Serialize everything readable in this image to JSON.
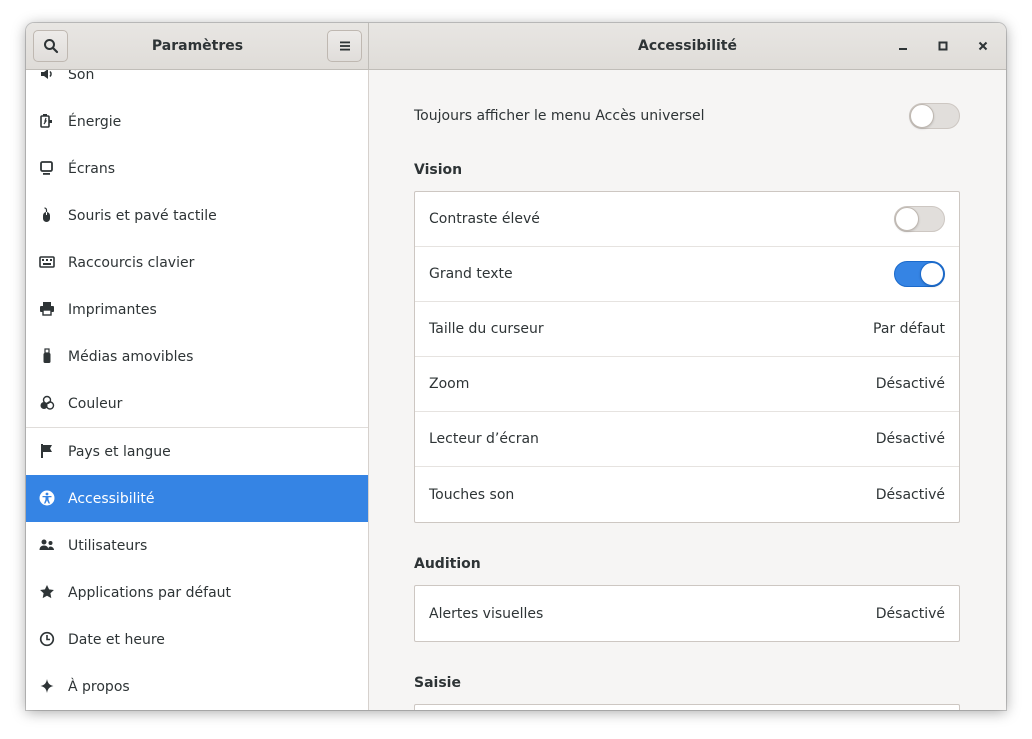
{
  "window": {
    "sidebar_title": "Paramètres",
    "page_title": "Accessibilité"
  },
  "icons": {
    "search": "search-icon",
    "menu": "hamburger-menu-icon",
    "minimize": "minimize-icon",
    "maximize": "maximize-icon",
    "close": "close-icon"
  },
  "colors": {
    "accent": "#3584e4",
    "sidebar_bg": "#ffffff",
    "content_bg": "#f6f5f4"
  },
  "sidebar": {
    "items": [
      {
        "label": "Son",
        "icon": "speaker-icon"
      },
      {
        "label": "Énergie",
        "icon": "power-icon"
      },
      {
        "label": "Écrans",
        "icon": "display-icon"
      },
      {
        "label": "Souris et pavé tactile",
        "icon": "mouse-icon"
      },
      {
        "label": "Raccourcis clavier",
        "icon": "keyboard-icon"
      },
      {
        "label": "Imprimantes",
        "icon": "printer-icon"
      },
      {
        "label": "Médias amovibles",
        "icon": "usb-drive-icon"
      },
      {
        "label": "Couleur",
        "icon": "color-icon"
      },
      {
        "label": "Pays et langue",
        "icon": "flag-icon"
      },
      {
        "label": "Accessibilité",
        "icon": "accessibility-icon",
        "active": true
      },
      {
        "label": "Utilisateurs",
        "icon": "users-icon"
      },
      {
        "label": "Applications par défaut",
        "icon": "star-icon"
      },
      {
        "label": "Date et heure",
        "icon": "clock-icon"
      },
      {
        "label": "À propos",
        "icon": "sparkle-icon"
      }
    ]
  },
  "main": {
    "always_show_label": "Toujours afficher le menu Accès universel",
    "always_show_on": false,
    "sections": {
      "vision": {
        "title": "Vision",
        "rows": [
          {
            "label": "Contraste élevé",
            "switch": false
          },
          {
            "label": "Grand texte",
            "switch": true
          },
          {
            "label": "Taille du curseur",
            "value": "Par défaut"
          },
          {
            "label": "Zoom",
            "value": "Désactivé"
          },
          {
            "label": "Lecteur d’écran",
            "value": "Désactivé"
          },
          {
            "label": "Touches son",
            "value": "Désactivé"
          }
        ]
      },
      "hearing": {
        "title": "Audition",
        "rows": [
          {
            "label": "Alertes visuelles",
            "value": "Désactivé"
          }
        ]
      },
      "typing": {
        "title": "Saisie"
      }
    }
  }
}
